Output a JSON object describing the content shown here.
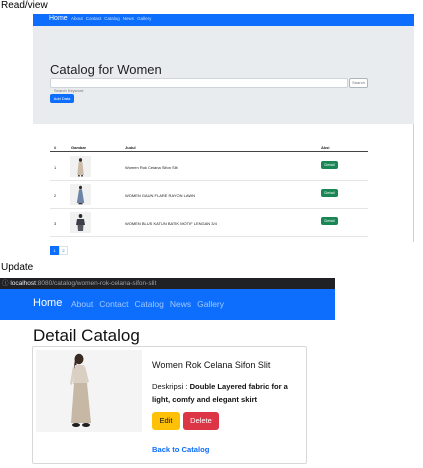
{
  "labels": {
    "read_view": "Read/view",
    "update": "Update"
  },
  "read": {
    "nav": {
      "brand": "Home",
      "links": [
        "About",
        "Contact",
        "Catalog",
        "News",
        "Gallery"
      ]
    },
    "title": "Catalog for Women",
    "search": {
      "placeholder": "Search Keyword",
      "button": "Search"
    },
    "add_button": "Add Data",
    "table": {
      "headers": [
        "#",
        "Gambar",
        "Judul",
        "Aksi"
      ],
      "rows": [
        {
          "num": "1",
          "title": "Women Rok Celana Sifon Slit",
          "action": "Detail"
        },
        {
          "num": "2",
          "title": "WOMEN GAUN FLARE RAYON LAWN",
          "action": "Detail"
        },
        {
          "num": "3",
          "title": "WOMEN BLUS KATUN BATIK MOTIF LENGAN 3/4",
          "action": "Detail"
        }
      ]
    },
    "pagination": [
      "1",
      "2"
    ]
  },
  "update": {
    "url": {
      "host": "localhost",
      "path": ":8080/catalog/women-rok-celana-sifon-slit"
    },
    "nav": {
      "brand": "Home",
      "links": [
        "About",
        "Contact",
        "Catalog",
        "News",
        "Gallery"
      ]
    },
    "title": "Detail Catalog",
    "card": {
      "name": "Women Rok Celana Sifon Slit",
      "desc_label": "Deskripsi :",
      "desc_value": "Double Layered fabric for a light, comfy and elegant skirt",
      "edit": "Edit",
      "delete": "Delete",
      "back": "Back to Catalog"
    }
  },
  "colors": {
    "primary": "#0d6efd",
    "success": "#198754",
    "warning": "#ffc107",
    "danger": "#dc3545",
    "jumbotron": "#e9ecef",
    "urlbar": "#202124"
  }
}
